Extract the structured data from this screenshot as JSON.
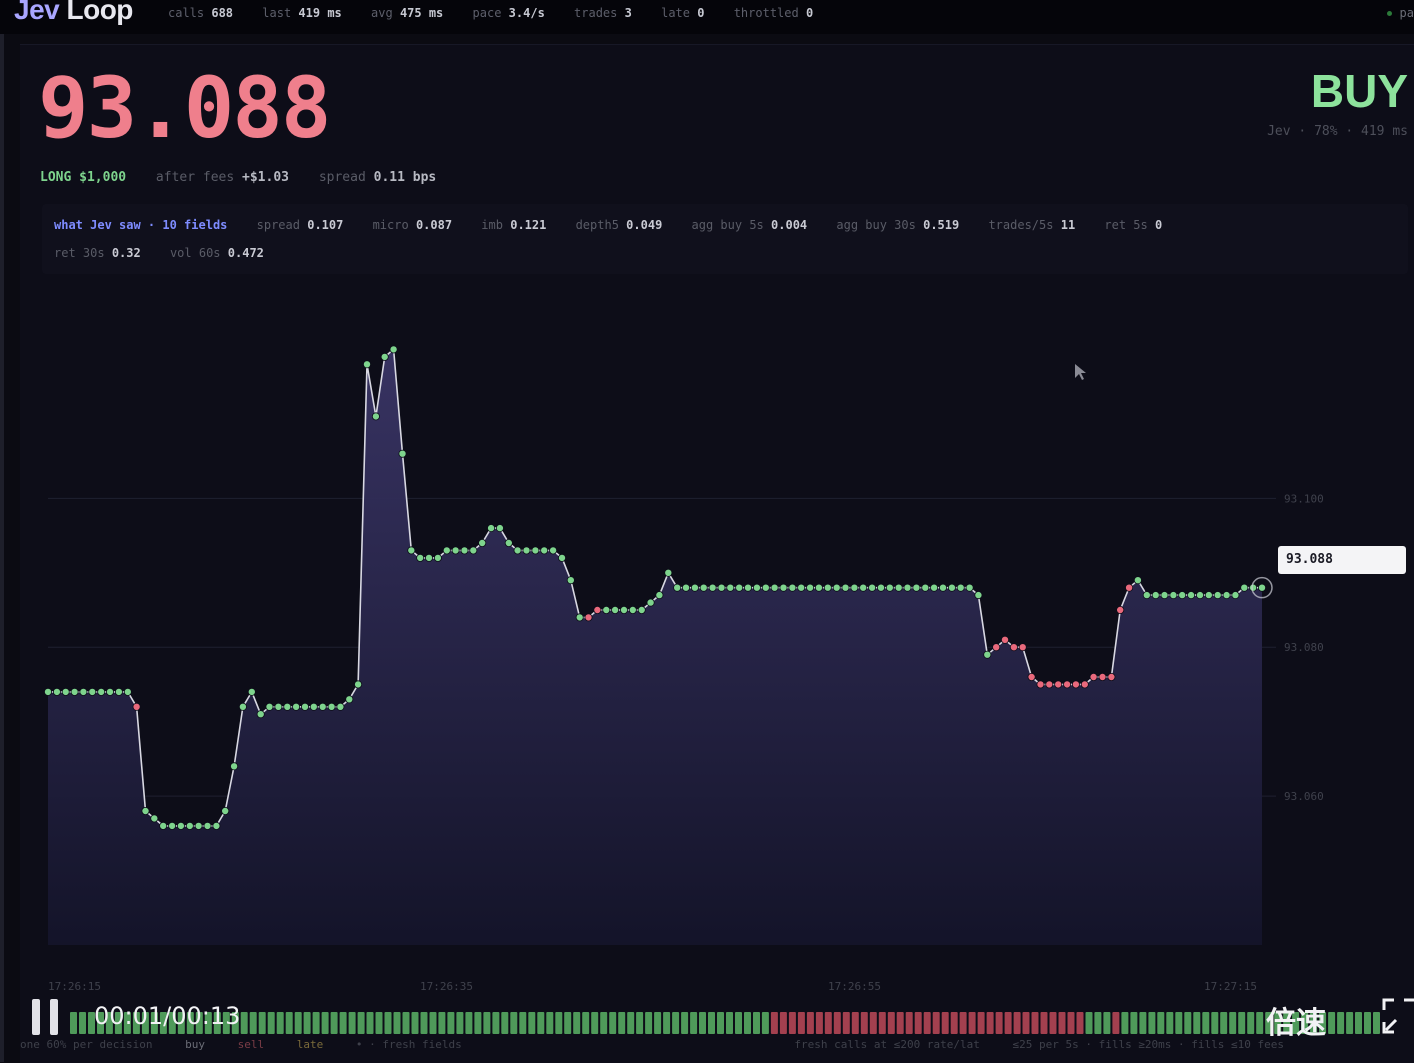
{
  "header": {
    "brand_prefix": "Jev",
    "brand_suffix": " Loop",
    "stats": [
      {
        "label": "calls",
        "value": "688"
      },
      {
        "label": "last",
        "value": "419 ms"
      },
      {
        "label": "avg",
        "value": "475 ms"
      },
      {
        "label": "pace",
        "value": "3.4/s"
      },
      {
        "label": "trades",
        "value": "3"
      },
      {
        "label": "late",
        "value": "0"
      },
      {
        "label": "throttled",
        "value": "0"
      }
    ],
    "right_label": "pa"
  },
  "quote": {
    "price": "93.088",
    "signal": "BUY",
    "signal_meta": "Jev · 78% · 419 ms",
    "position": "LONG $1,000",
    "after_fees_label": "after fees",
    "after_fees_value": "+$1.03",
    "spread_label": "spread",
    "spread_value": "0.11 bps"
  },
  "features": {
    "heading": "what Jev saw · 10 fields",
    "items": [
      {
        "label": "spread",
        "value": "0.107"
      },
      {
        "label": "micro",
        "value": "0.087"
      },
      {
        "label": "imb",
        "value": "0.121"
      },
      {
        "label": "depth5",
        "value": "0.049"
      },
      {
        "label": "agg buy 5s",
        "value": "0.004"
      },
      {
        "label": "agg buy 30s",
        "value": "0.519"
      },
      {
        "label": "trades/5s",
        "value": "11"
      },
      {
        "label": "ret 5s",
        "value": "0"
      },
      {
        "label": "ret 30s",
        "value": "0.32"
      },
      {
        "label": "vol 60s",
        "value": "0.472"
      }
    ]
  },
  "chart_data": {
    "type": "line",
    "ylim": [
      93.04,
      93.13
    ],
    "y_ticks": [
      "93.100",
      "93.080",
      "93.060"
    ],
    "x_ticks": [
      "17:26:15",
      "17:26:35",
      "17:26:55",
      "17:27:15"
    ],
    "current_price_tag": "93.088",
    "grid": true,
    "series": [
      {
        "values": [
          93.074,
          93.074,
          93.074,
          93.074,
          93.074,
          93.074,
          93.074,
          93.074,
          93.074,
          93.074,
          93.072,
          93.058,
          93.057,
          93.056,
          93.056,
          93.056,
          93.056,
          93.056,
          93.056,
          93.056,
          93.058,
          93.064,
          93.072,
          93.074,
          93.071,
          93.072,
          93.072,
          93.072,
          93.072,
          93.072,
          93.072,
          93.072,
          93.072,
          93.072,
          93.073,
          93.075,
          93.118,
          93.111,
          93.119,
          93.12,
          93.106,
          93.093,
          93.092,
          93.092,
          93.092,
          93.093,
          93.093,
          93.093,
          93.093,
          93.094,
          93.096,
          93.096,
          93.094,
          93.093,
          93.093,
          93.093,
          93.093,
          93.093,
          93.092,
          93.089,
          93.084,
          93.084,
          93.085,
          93.085,
          93.085,
          93.085,
          93.085,
          93.085,
          93.086,
          93.087,
          93.09,
          93.088,
          93.088,
          93.088,
          93.088,
          93.088,
          93.088,
          93.088,
          93.088,
          93.088,
          93.088,
          93.088,
          93.088,
          93.088,
          93.088,
          93.088,
          93.088,
          93.088,
          93.088,
          93.088,
          93.088,
          93.088,
          93.088,
          93.088,
          93.088,
          93.088,
          93.088,
          93.088,
          93.088,
          93.088,
          93.088,
          93.088,
          93.088,
          93.088,
          93.088,
          93.087,
          93.079,
          93.08,
          93.081,
          93.08,
          93.08,
          93.076,
          93.075,
          93.075,
          93.075,
          93.075,
          93.075,
          93.075,
          93.076,
          93.076,
          93.076,
          93.085,
          93.088,
          93.089,
          93.087,
          93.087,
          93.087,
          93.087,
          93.087,
          93.087,
          93.087,
          93.087,
          93.087,
          93.087,
          93.087,
          93.088,
          93.088,
          93.088
        ],
        "direction": [
          "up",
          "up",
          "up",
          "up",
          "up",
          "up",
          "up",
          "up",
          "up",
          "up",
          "down",
          "up",
          "up",
          "up",
          "up",
          "up",
          "up",
          "up",
          "up",
          "up",
          "up",
          "up",
          "up",
          "up",
          "up",
          "up",
          "up",
          "up",
          "up",
          "up",
          "up",
          "up",
          "up",
          "up",
          "up",
          "up",
          "up",
          "up",
          "up",
          "up",
          "up",
          "up",
          "up",
          "up",
          "up",
          "up",
          "up",
          "up",
          "up",
          "up",
          "up",
          "up",
          "up",
          "up",
          "up",
          "up",
          "up",
          "up",
          "up",
          "up",
          "up",
          "down",
          "down",
          "up",
          "up",
          "up",
          "up",
          "up",
          "up",
          "up",
          "up",
          "up",
          "up",
          "up",
          "up",
          "up",
          "up",
          "up",
          "up",
          "up",
          "up",
          "up",
          "up",
          "up",
          "up",
          "up",
          "up",
          "up",
          "up",
          "up",
          "up",
          "up",
          "up",
          "up",
          "up",
          "up",
          "up",
          "up",
          "up",
          "up",
          "up",
          "up",
          "up",
          "up",
          "up",
          "up",
          "up",
          "down",
          "down",
          "down",
          "down",
          "down",
          "down",
          "down",
          "down",
          "down",
          "down",
          "down",
          "down",
          "down",
          "down",
          "down",
          "down",
          "up",
          "up",
          "up",
          "up",
          "up",
          "up",
          "up",
          "up",
          "up",
          "up",
          "up",
          "up",
          "up",
          "up",
          "up"
        ]
      }
    ]
  },
  "playback": {
    "time": "00:01/00:13",
    "speed_label": "倍速"
  },
  "timeline": {
    "segments": "ggggggggggggggggggggggggggggggggggggggggggggggggggggggggggggggggggggggggggggggrrrrrrrrrrrrrrrrrrrrrrrrrrrrrrrrrrrgggrggggggggggggggggggggggggggggg"
  },
  "footer": {
    "items": [
      "one 60% per decision",
      "buy",
      "sell",
      "late",
      "• · fresh fields",
      "fresh calls at ≤200 rate/lat",
      "≤25 per 5s · fills ≥20ms · fills ≤10 fees"
    ]
  },
  "colors": {
    "up": "#7ed48d",
    "down": "#e9697c",
    "price": "#ef7f8c",
    "buy": "#8de29c",
    "area_top": "#3a3566"
  }
}
